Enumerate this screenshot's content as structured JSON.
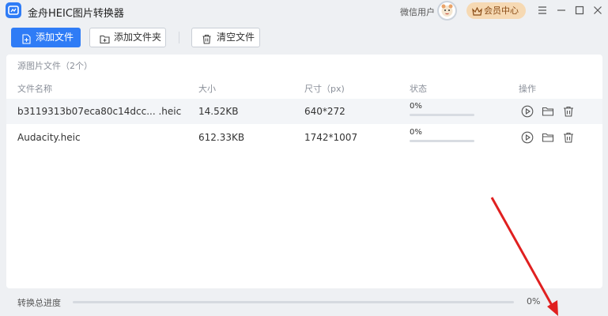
{
  "app": {
    "title": "金舟HEIC图片转换器",
    "wechat_user": "微信用户",
    "vip_label": "会员中心"
  },
  "toolbar": {
    "add_file": "添加文件",
    "add_folder": "添加文件夹",
    "clear_files": "清空文件"
  },
  "panel": {
    "source_title": "源图片文件（2个）",
    "columns": [
      "文件名称",
      "大小",
      "尺寸（px)",
      "状态",
      "操作"
    ]
  },
  "files": [
    {
      "name": "b3119313b07eca80c14dcc... .heic",
      "size": "14.52KB",
      "dimensions": "640*272",
      "status": "0%",
      "progress": 0
    },
    {
      "name": "Audacity.heic",
      "size": "612.33KB",
      "dimensions": "1742*1007",
      "status": "0%",
      "progress": 0
    }
  ],
  "footer": {
    "label": "转换总进度",
    "percent_text": "0%",
    "progress": 0
  },
  "colors": {
    "accent": "#2f7cf6",
    "vip_bg": "#f6d9b3",
    "annotation": "#e02020"
  },
  "icons": [
    "app-logo-icon",
    "avatar-icon",
    "crown-icon",
    "menu-icon",
    "minimize-icon",
    "maximize-icon",
    "close-icon",
    "add-file-icon",
    "add-folder-icon",
    "trash-icon",
    "play-icon",
    "folder-icon",
    "delete-icon"
  ]
}
